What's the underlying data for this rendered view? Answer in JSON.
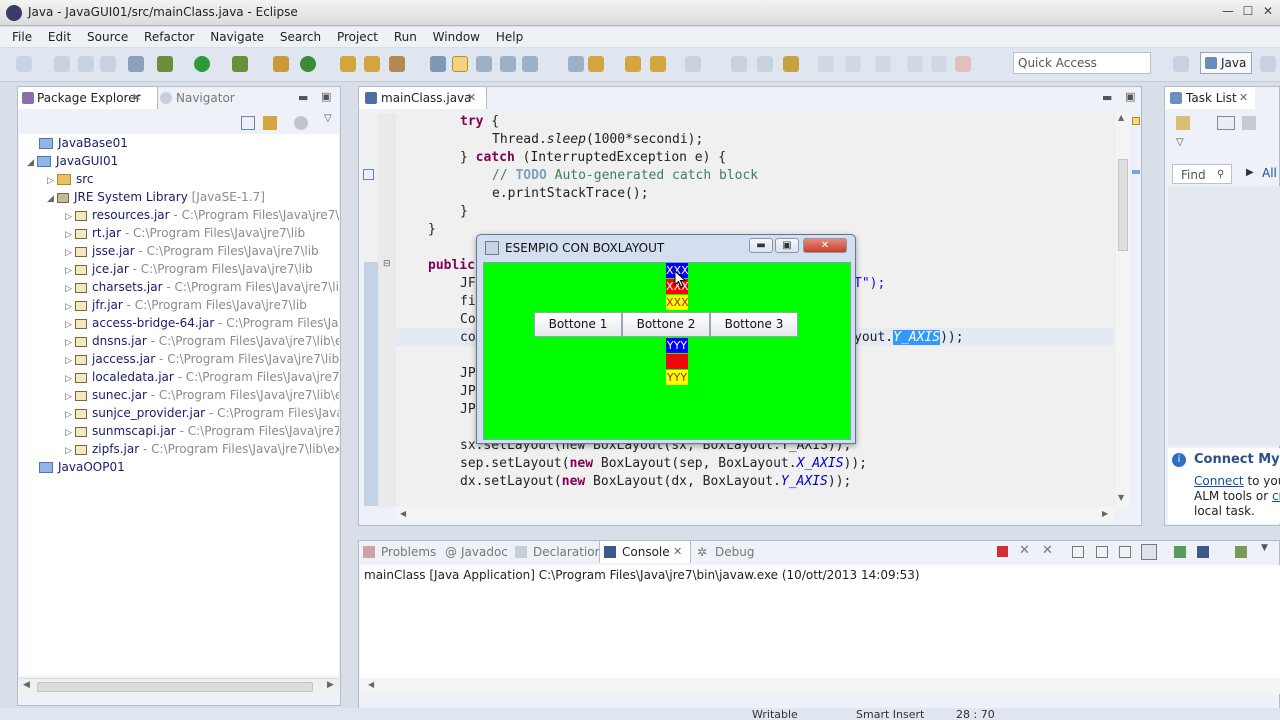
{
  "window": {
    "title": "Java - JavaGUI01/src/mainClass.java - Eclipse",
    "min": "—",
    "max": "☐",
    "close": "✕"
  },
  "menu": [
    "File",
    "Edit",
    "Source",
    "Refactor",
    "Navigate",
    "Search",
    "Project",
    "Run",
    "Window",
    "Help"
  ],
  "toolbar": {
    "quick_access_placeholder": "Quick Access",
    "perspective": "Java"
  },
  "package_explorer": {
    "tab_label": "Package Explorer",
    "navigator_label": "Navigator",
    "tree": [
      {
        "name": "JavaBase01",
        "kind": "project"
      },
      {
        "name": "JavaGUI01",
        "kind": "project"
      },
      {
        "name": "src",
        "kind": "folder"
      },
      {
        "name": "JRE System Library",
        "extra": "[JavaSE-1.7]",
        "kind": "library"
      },
      {
        "name": "resources.jar",
        "path": "- C:\\Program Files\\Java\\jre7\\lib"
      },
      {
        "name": "rt.jar",
        "path": "- C:\\Program Files\\Java\\jre7\\lib"
      },
      {
        "name": "jsse.jar",
        "path": "- C:\\Program Files\\Java\\jre7\\lib"
      },
      {
        "name": "jce.jar",
        "path": "- C:\\Program Files\\Java\\jre7\\lib"
      },
      {
        "name": "charsets.jar",
        "path": "- C:\\Program Files\\Java\\jre7\\lib"
      },
      {
        "name": "jfr.jar",
        "path": "- C:\\Program Files\\Java\\jre7\\lib"
      },
      {
        "name": "access-bridge-64.jar",
        "path": "- C:\\Program Files\\Java\\j"
      },
      {
        "name": "dnsns.jar",
        "path": "- C:\\Program Files\\Java\\jre7\\lib\\ext"
      },
      {
        "name": "jaccess.jar",
        "path": "- C:\\Program Files\\Java\\jre7\\lib\\ext"
      },
      {
        "name": "localedata.jar",
        "path": "- C:\\Program Files\\Java\\jre7\\lib\\"
      },
      {
        "name": "sunec.jar",
        "path": "- C:\\Program Files\\Java\\jre7\\lib\\ext"
      },
      {
        "name": "sunjce_provider.jar",
        "path": "- C:\\Program Files\\Java\\jre"
      },
      {
        "name": "sunmscapi.jar",
        "path": "- C:\\Program Files\\Java\\jre7\\lib\\"
      },
      {
        "name": "zipfs.jar",
        "path": "- C:\\Program Files\\Java\\jre7\\lib\\ext"
      },
      {
        "name": "JavaOOP01",
        "kind": "project"
      }
    ]
  },
  "editor": {
    "tab_label": "mainClass.java",
    "lines": {
      "l1_kw": "try",
      "l1_rest": " {",
      "l2_a": "Thread.",
      "l2_b": "sleep",
      "l2_c": "(1000*secondi);",
      "l3_a": "} ",
      "l3_kw": "catch",
      "l3_b": " (InterruptedException e) {",
      "l4_a": "// ",
      "l4_todo": "TODO",
      "l4_b": " Auto-generated catch block",
      "l5": "e.printStackTrace();",
      "l6": "}",
      "l7": "}",
      "l8_kw": "public",
      "l9_a": "JF",
      "l9_b": "T\");",
      "l10": "fi",
      "l11": "Co",
      "l12_a": "co",
      "l12_b": "yout.",
      "l12_sel": "Y_AXIS",
      "l12_c": "));",
      "l13": "JP",
      "l14": "JP",
      "l15": "JP",
      "l16": "sx.setLayout(new BoxLayout(sx, BoxLayout.Y_AXIS));",
      "l17_a": "sep.setLayout(",
      "l17_kw": "new",
      "l17_b": " BoxLayout(sep, BoxLayout.",
      "l17_f": "X_AXIS",
      "l17_c": "));",
      "l18_a": "dx.setLayout(",
      "l18_kw": "new",
      "l18_b": " BoxLayout(dx, BoxLayout.",
      "l18_f": "Y_AXIS",
      "l18_c": "));"
    }
  },
  "swing_window": {
    "title": "ESEMPIO CON BOXLAYOUT",
    "top_labels": [
      "XXX",
      "XXX",
      "XXX"
    ],
    "bottom_labels": [
      "YYY",
      "YYY",
      "YYY"
    ],
    "buttons": [
      "Bottone 1",
      "Bottone 2",
      "Bottone 3"
    ],
    "green": "#00ff00"
  },
  "task_list": {
    "tab_label": "Task List",
    "find_placeholder": "Find",
    "all": "All",
    "connect_title": "Connect Mylyn",
    "connect_link": "Connect",
    "connect_text1": " to your",
    "connect_text2": "ALM tools or ",
    "connect_link2": "cre",
    "connect_text3": "local task."
  },
  "console": {
    "tabs": [
      "Problems",
      "Javadoc",
      "Declaration",
      "Console",
      "Debug"
    ],
    "line": "mainClass [Java Application] C:\\Program Files\\Java\\jre7\\bin\\javaw.exe (10/ott/2013 14:09:53)"
  },
  "statusbar": {
    "writable": "Writable",
    "insert": "Smart Insert",
    "pos": "28 : 70"
  }
}
